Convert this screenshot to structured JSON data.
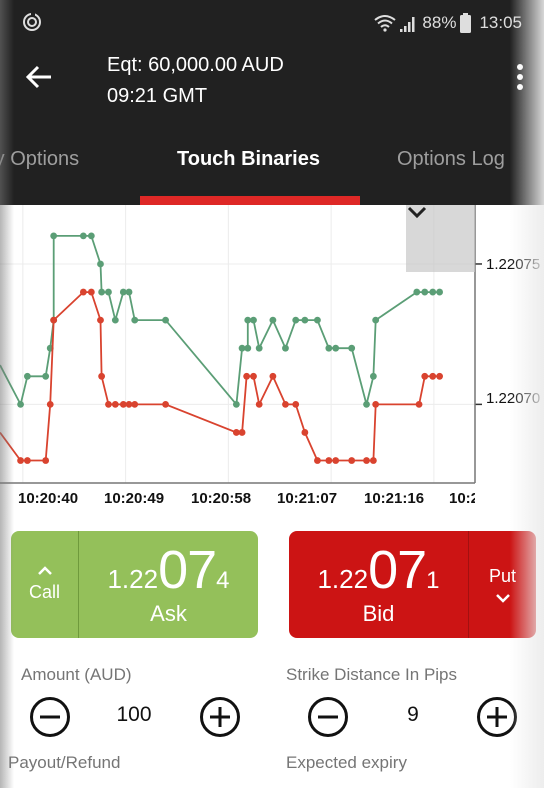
{
  "status_bar": {
    "left_icon": "sync-circle-icon",
    "wifi_icon": "wifi-icon",
    "signal_icon": "signal-icon",
    "battery_percent": "88%",
    "battery_icon": "battery-icon",
    "time": "13:05"
  },
  "app_bar": {
    "back_icon": "arrow-left-icon",
    "equity": "Eqt: 60,000.00 AUD",
    "gmt_time": "09:21 GMT",
    "menu_icon": "more-vertical-icon"
  },
  "tabs": [
    {
      "label": "Binary Options",
      "visible_text": "ry Options",
      "active": false
    },
    {
      "label": "Touch Binaries",
      "active": true
    },
    {
      "label": "Options Log",
      "active": false
    }
  ],
  "colors": {
    "accent_red": "#de2826",
    "ask_green": "#94c05a",
    "bid_red": "#cc1414",
    "line_green": "#5b9e76",
    "line_red": "#d9432f"
  },
  "chart_data": {
    "type": "line",
    "title": "",
    "xlabel": "",
    "ylabel": "",
    "x_tick_labels": [
      "10:20:40",
      "10:20:49",
      "10:20:58",
      "10:21:07",
      "10:21:16",
      "10:2"
    ],
    "y_tick_labels": [
      "1.22075",
      "1.22070"
    ],
    "ylim": [
      1.220672,
      1.220771
    ],
    "grid": true,
    "collapse_icon": "chevron-down-icon",
    "x_unit": "seconds after 10:20:40",
    "xlim": [
      -2.0,
      39.6
    ],
    "series": [
      {
        "name": "Ask",
        "color": "#5b9e76",
        "points": [
          [
            -2.0,
            1.220714
          ],
          [
            -0.2,
            1.2207
          ],
          [
            0.4,
            1.22071
          ],
          [
            2.0,
            1.22071
          ],
          [
            2.4,
            1.22072
          ],
          [
            2.7,
            1.22073
          ],
          [
            2.7,
            1.22076
          ],
          [
            5.3,
            1.22076
          ],
          [
            6.0,
            1.22076
          ],
          [
            6.8,
            1.22075
          ],
          [
            6.9,
            1.22074
          ],
          [
            7.5,
            1.22074
          ],
          [
            8.1,
            1.22073
          ],
          [
            8.8,
            1.22074
          ],
          [
            9.3,
            1.22074
          ],
          [
            9.8,
            1.22073
          ],
          [
            12.5,
            1.22073
          ],
          [
            18.7,
            1.2207
          ],
          [
            19.2,
            1.22072
          ],
          [
            19.7,
            1.22072
          ],
          [
            19.7,
            1.22073
          ],
          [
            20.2,
            1.22073
          ],
          [
            20.7,
            1.22072
          ],
          [
            21.9,
            1.22073
          ],
          [
            23.0,
            1.22072
          ],
          [
            23.9,
            1.22073
          ],
          [
            24.7,
            1.22073
          ],
          [
            25.8,
            1.22073
          ],
          [
            26.8,
            1.22072
          ],
          [
            27.4,
            1.22072
          ],
          [
            28.8,
            1.22072
          ],
          [
            30.1,
            1.2207
          ],
          [
            30.7,
            1.22071
          ],
          [
            30.9,
            1.22073
          ],
          [
            34.5,
            1.22074
          ],
          [
            35.2,
            1.22074
          ],
          [
            35.9,
            1.22074
          ],
          [
            36.5,
            1.22074
          ]
        ]
      },
      {
        "name": "Bid",
        "color": "#d9432f",
        "points": [
          [
            -2.0,
            1.22069
          ],
          [
            -0.2,
            1.22068
          ],
          [
            0.4,
            1.22068
          ],
          [
            2.0,
            1.22068
          ],
          [
            2.4,
            1.2207
          ],
          [
            2.7,
            1.22073
          ],
          [
            5.3,
            1.22074
          ],
          [
            6.0,
            1.22074
          ],
          [
            6.8,
            1.22073
          ],
          [
            6.9,
            1.22071
          ],
          [
            7.5,
            1.2207
          ],
          [
            8.1,
            1.2207
          ],
          [
            8.8,
            1.2207
          ],
          [
            9.3,
            1.2207
          ],
          [
            9.8,
            1.2207
          ],
          [
            12.5,
            1.2207
          ],
          [
            18.7,
            1.22069
          ],
          [
            19.2,
            1.22069
          ],
          [
            19.6,
            1.22071
          ],
          [
            20.2,
            1.22071
          ],
          [
            20.7,
            1.2207
          ],
          [
            21.9,
            1.22071
          ],
          [
            23.0,
            1.2207
          ],
          [
            23.9,
            1.2207
          ],
          [
            24.7,
            1.22069
          ],
          [
            25.8,
            1.22068
          ],
          [
            26.8,
            1.22068
          ],
          [
            27.4,
            1.22068
          ],
          [
            28.8,
            1.22068
          ],
          [
            30.1,
            1.22068
          ],
          [
            30.7,
            1.22068
          ],
          [
            30.9,
            1.2207
          ],
          [
            34.7,
            1.2207
          ],
          [
            35.2,
            1.22071
          ],
          [
            35.9,
            1.22071
          ],
          [
            36.5,
            1.22071
          ]
        ]
      }
    ]
  },
  "call_button": {
    "icon": "chevron-up-icon",
    "label": "Call",
    "price_prefix": "1.22",
    "price_big": "07",
    "price_suffix": "4",
    "price_full": "1.22074",
    "price_label": "Ask"
  },
  "put_button": {
    "icon": "chevron-down-icon",
    "label": "Put",
    "price_prefix": "1.22",
    "price_big": "07",
    "price_suffix": "1",
    "price_full": "1.22071",
    "price_label": "Bid"
  },
  "amount": {
    "label": "Amount (AUD)",
    "value": "100",
    "minus_icon": "minus-circle-icon",
    "plus_icon": "plus-circle-icon"
  },
  "strike_distance": {
    "label": "Strike Distance In Pips",
    "value": "9",
    "minus_icon": "minus-circle-icon",
    "plus_icon": "plus-circle-icon"
  },
  "payout_label": "Payout/Refund",
  "expiry_label": "Expected expiry"
}
